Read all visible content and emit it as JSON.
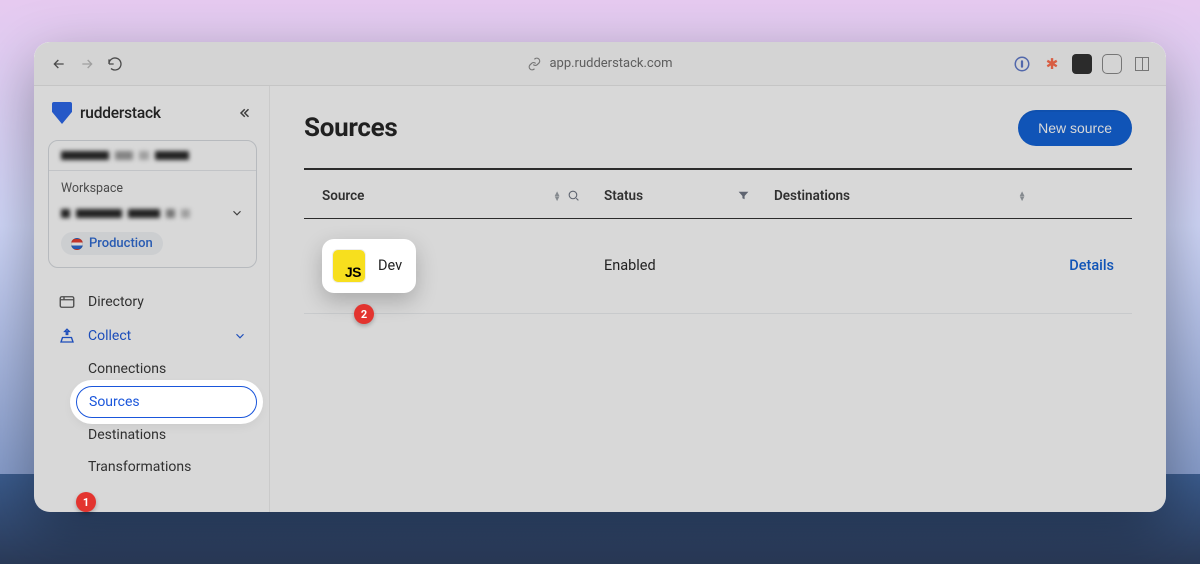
{
  "browser": {
    "url_host": "app.rudderstack.com"
  },
  "brand": {
    "name": "rudderstack"
  },
  "workspace": {
    "label": "Workspace",
    "environment": "Production"
  },
  "sidebar": {
    "items": [
      {
        "label": "Directory"
      },
      {
        "label": "Collect"
      }
    ],
    "collect_children": [
      {
        "label": "Connections"
      },
      {
        "label": "Sources"
      },
      {
        "label": "Destinations"
      },
      {
        "label": "Transformations"
      }
    ]
  },
  "page": {
    "title": "Sources",
    "new_button": "New source"
  },
  "table": {
    "headers": {
      "source": "Source",
      "status": "Status",
      "destinations": "Destinations"
    },
    "rows": [
      {
        "icon": "JS",
        "name": "Dev",
        "status": "Enabled",
        "action": "Details"
      }
    ]
  },
  "callouts": {
    "one": "1",
    "two": "2"
  }
}
